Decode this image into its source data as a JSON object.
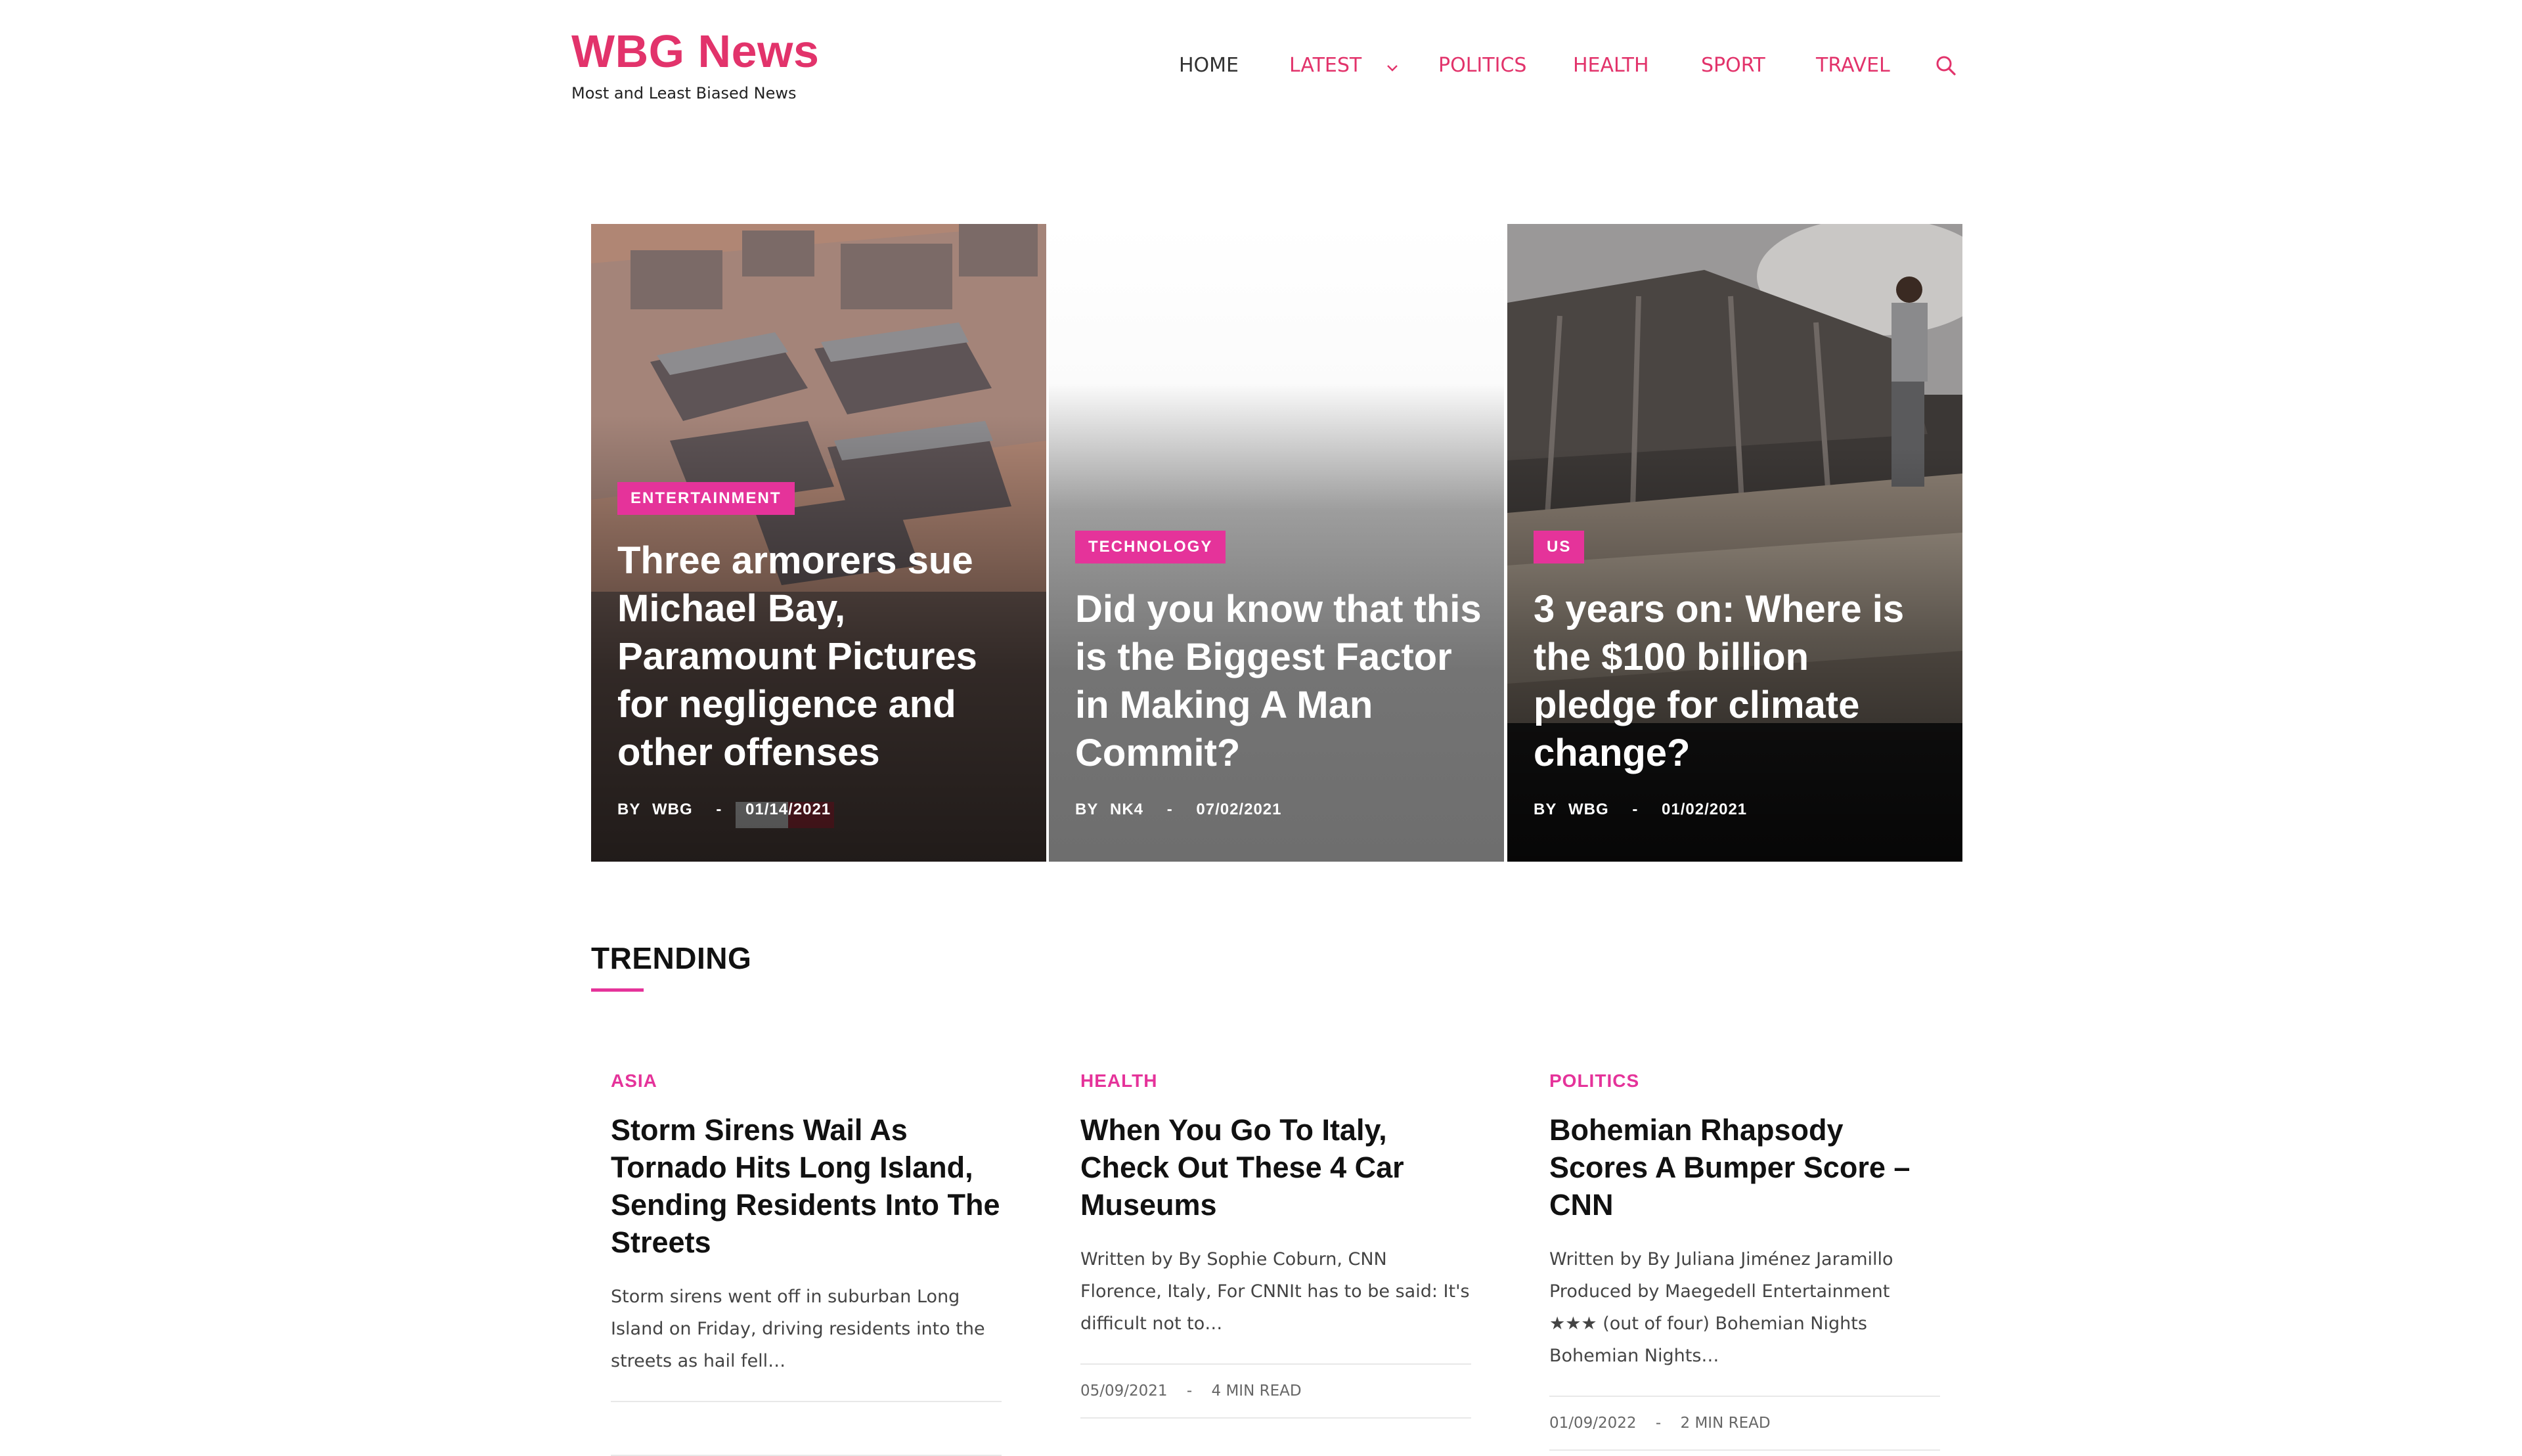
{
  "site": {
    "title": "WBG News",
    "tagline": "Most and Least Biased News"
  },
  "nav": {
    "items": [
      {
        "label": "HOME"
      },
      {
        "label": "LATEST"
      },
      {
        "label": "POLITICS"
      },
      {
        "label": "HEALTH"
      },
      {
        "label": "SPORT"
      },
      {
        "label": "TRAVEL"
      }
    ],
    "search_icon": "search-icon",
    "latest_icon": "chevron-down-icon"
  },
  "colors": {
    "brand": "#e2336b",
    "badge": "#e5339a",
    "text": "#111111"
  },
  "hero": [
    {
      "category": "ENTERTAINMENT",
      "title": "Three armorers sue Michael Bay, Paramount Pictures for negligence and other offenses",
      "by": "BY",
      "author": "WBG",
      "sep": "-",
      "date": "01/14/2021"
    },
    {
      "category": "TECHNOLOGY",
      "title": "Did you know that this is the Biggest Factor in Making A Man Commit?",
      "by": "BY",
      "author": "NK4",
      "sep": "-",
      "date": "07/02/2021"
    },
    {
      "category": "US",
      "title": "3 years on: Where is the $100 billion pledge for climate change?",
      "by": "BY",
      "author": "WBG",
      "sep": "-",
      "date": "01/02/2021"
    }
  ],
  "trending": {
    "heading": "TRENDING",
    "items": [
      {
        "category": "ASIA",
        "title": "Storm Sirens Wail As Tornado Hits Long Island, Sending Residents Into The Streets",
        "excerpt": "Storm sirens went off in suburban Long Island on Friday, driving residents into the streets as hail fell…",
        "date": "",
        "sep": "",
        "read_time": ""
      },
      {
        "category": "HEALTH",
        "title": "When You Go To Italy, Check Out These 4 Car Museums",
        "excerpt": "Written by By Sophie Coburn, CNN Florence, Italy, For CNNIt has to be said: It's difficult not to…",
        "date": "05/09/2021",
        "sep": "-",
        "read_time": "4 MIN READ"
      },
      {
        "category": "POLITICS",
        "title": "Bohemian Rhapsody Scores A Bumper Score – CNN",
        "excerpt": "Written by By Juliana Jiménez Jaramillo Produced by Maegedell Entertainment ★★★ (out of four) Bohemian Nights Bohemian Nights…",
        "date": "01/09/2022",
        "sep": "-",
        "read_time": "2 MIN READ"
      }
    ]
  }
}
